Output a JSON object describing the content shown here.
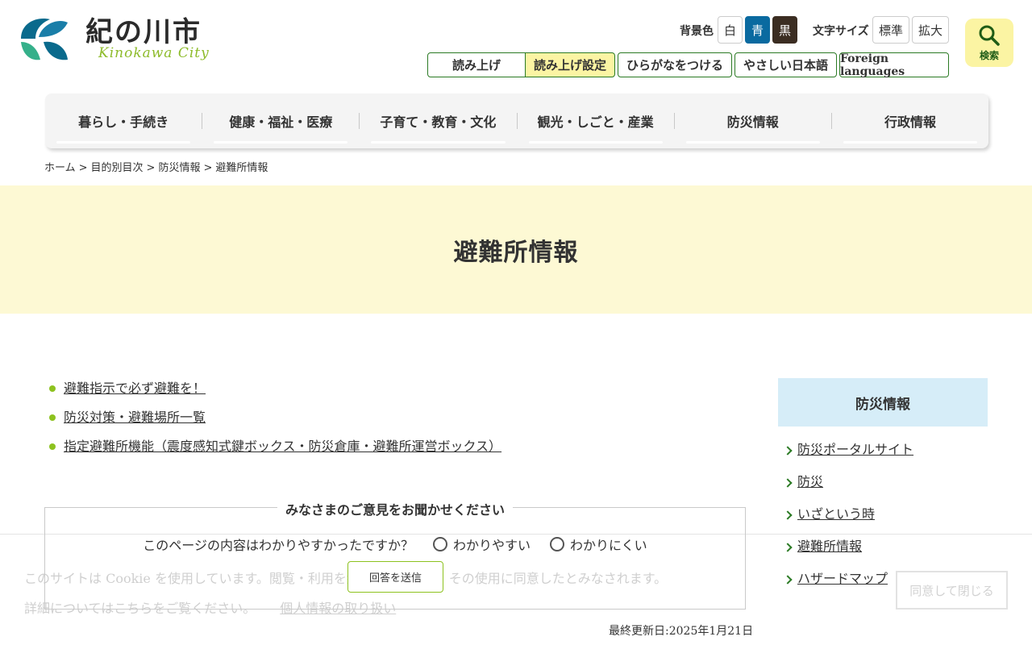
{
  "header": {
    "logo_jp": "紀の川市",
    "logo_en": "Kinokawa City",
    "bg_color_label": "背景色",
    "bg_options": [
      "白",
      "青",
      "黒"
    ],
    "font_size_label": "文字サイズ",
    "font_size_options": [
      "標準",
      "拡大"
    ],
    "search_label": "検索",
    "tools": [
      "読み上げ",
      "読み上げ設定",
      "ひらがなをつける",
      "やさしい日本語",
      "Foreign languages"
    ]
  },
  "nav": {
    "items": [
      "暮らし・手続き",
      "健康・福祉・医療",
      "子育て・教育・文化",
      "観光・しごと・産業",
      "防災情報",
      "行政情報"
    ]
  },
  "breadcrumb": [
    "ホーム",
    "目的別目次",
    "防災情報",
    "避難所情報"
  ],
  "page": {
    "title": "避難所情報",
    "links": [
      "避難指示で必ず避難を！",
      "防災対策・避難場所一覧",
      "指定避難所機能（震度感知式鍵ボックス・防災倉庫・避難所運営ボックス）"
    ]
  },
  "feedback": {
    "title": "みなさまのご意見をお聞かせください",
    "question": "このページの内容はわかりやすかったですか？",
    "options": [
      "わかりやすい",
      "わかりにくい"
    ],
    "submit": "回答を送信"
  },
  "last_updated": "最終更新日:2025年1月21日",
  "sidebar": {
    "title": "防災情報",
    "items": [
      "防災ポータルサイト",
      "防災",
      "いざという時",
      "避難所情報",
      "ハザードマップ"
    ]
  },
  "cookie": {
    "line1": "このサイトは Cookie を使用しています。閲覧・利用を継続することで、その使用に同意したとみなされます。",
    "line2": "詳細についてはこちらをご覧ください。",
    "privacy_link": "個人情報の取り扱い",
    "accept": "同意して閉じる"
  },
  "colors": {
    "accent_green": "#8dc21f",
    "dark_green": "#2b7a24",
    "title_band": "#fdf9d4",
    "sidebar_head": "#d6edf8",
    "yellow_button": "#fbf4a3",
    "blue_bg_option": "#0a6aa0",
    "black_bg_option": "#3b2d22"
  }
}
